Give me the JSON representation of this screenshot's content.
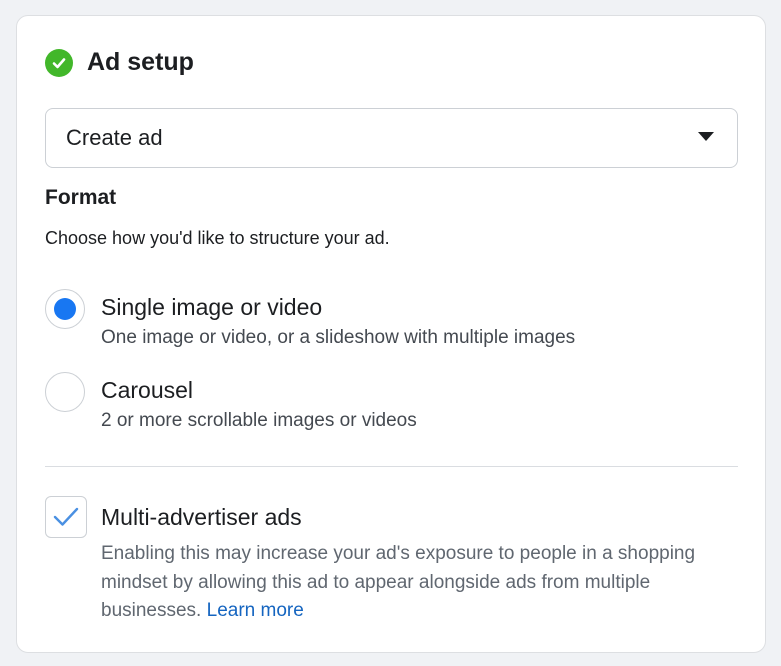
{
  "section": {
    "title": "Ad setup",
    "status_icon": "check-circle-icon",
    "status_color": "#42b72a"
  },
  "ad_select": {
    "value": "Create ad",
    "icon": "caret-down-icon"
  },
  "format": {
    "heading": "Format",
    "description": "Choose how you'd like to structure your ad.",
    "options": [
      {
        "label": "Single image or video",
        "sublabel": "One image or video, or a slideshow with multiple images",
        "selected": true
      },
      {
        "label": "Carousel",
        "sublabel": "2 or more scrollable images or videos",
        "selected": false
      }
    ],
    "selected_color": "#1877f2"
  },
  "multi_advertiser": {
    "label": "Multi-advertiser ads",
    "checked": true,
    "description": "Enabling this may increase your ad's exposure to people in a shopping mindset by allowing this ad to appear alongside ads from multiple businesses.",
    "link_text": "Learn more",
    "link_color": "#1565c0"
  }
}
